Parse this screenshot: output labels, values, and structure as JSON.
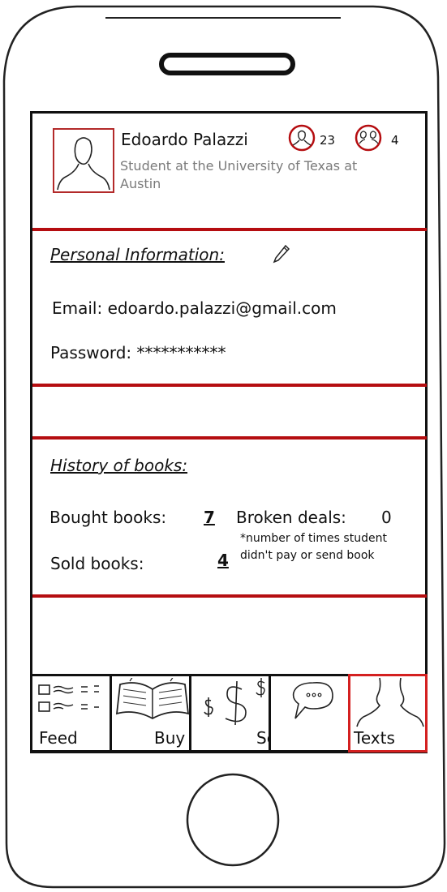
{
  "profile": {
    "name": "Edoardo Palazzi",
    "subtitle_line1": "Student at the University of Texas at",
    "subtitle_line2": "Austin",
    "followers_count": "23",
    "groups_count": "4"
  },
  "personal": {
    "title": "Personal Information:",
    "email_label": "Email: edoardo.palazzi@gmail.com",
    "password_label": "Password: ***********"
  },
  "history": {
    "title": "History of books:",
    "bought_label": "Bought books:",
    "bought_value": "7",
    "broken_label": "Broken deals:",
    "broken_value": "0",
    "note_line1": "*number of times student",
    "note_line2": "didn't pay or send book",
    "sold_label": "Sold books:",
    "sold_value": "4"
  },
  "nav": {
    "items": [
      {
        "label": "Feed",
        "icon": "feed-list-icon"
      },
      {
        "label": "Buy",
        "icon": "open-book-icon"
      },
      {
        "label": "Sell",
        "icon": "dollar-icon"
      },
      {
        "label": "",
        "icon": "chat-bubble-icon"
      },
      {
        "label": "Texts",
        "icon": "person-icon"
      }
    ],
    "active": "Texts"
  },
  "colors": {
    "accent": "#b50d10",
    "active_border": "#d42020"
  }
}
